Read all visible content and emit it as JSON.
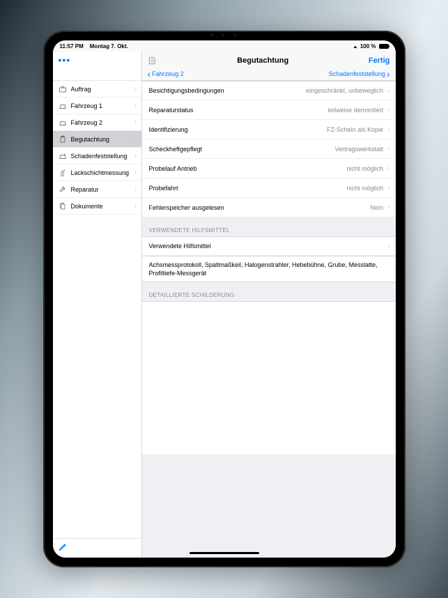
{
  "statusbar": {
    "time": "11:57 PM",
    "date": "Montag 7. Okt.",
    "battery": "100 %"
  },
  "sidebar": {
    "more_label": "•••",
    "items": [
      {
        "id": "auftrag",
        "label": "Auftrag",
        "icon": "briefcase"
      },
      {
        "id": "fahrzeug1",
        "label": "Fahrzeug 1",
        "icon": "car"
      },
      {
        "id": "fahrzeug2",
        "label": "Fahrzeug 2",
        "icon": "car"
      },
      {
        "id": "begutachtung",
        "label": "Begutachtung",
        "icon": "clipboard",
        "selected": true
      },
      {
        "id": "schadenfeststellung",
        "label": "Schadenfeststellung",
        "icon": "car-crash"
      },
      {
        "id": "lackschichtmessung",
        "label": "Lackschichtmessung",
        "icon": "spray"
      },
      {
        "id": "reparatur",
        "label": "Reparatur",
        "icon": "wrench"
      },
      {
        "id": "dokumente",
        "label": "Dokumente",
        "icon": "docs"
      }
    ]
  },
  "navbar": {
    "title": "Begutachtung",
    "done": "Fertig",
    "back": "Fahrzeug 2",
    "forward": "Schadenfeststellung"
  },
  "rows": [
    {
      "label": "Besichtigungsbedingungen",
      "value": "eingeschränkt, unbeweglich"
    },
    {
      "label": "Reparaturstatus",
      "value": "teilweise demontiert"
    },
    {
      "label": "Identifizierung",
      "value": "FZ-Schein als Kopie"
    },
    {
      "label": "Scheckheftgepflegt",
      "value": "Vertragswerkstatt"
    },
    {
      "label": "Probelauf Antrieb",
      "value": "nicht möglich"
    },
    {
      "label": "Probefahrt",
      "value": "nicht möglich"
    },
    {
      "label": "Fehlerspeicher ausgelesen",
      "value": "Nein"
    }
  ],
  "sections": {
    "tools_header": "Verwendete Hilfsmittel",
    "tools_row": "Verwendete Hilfsmittel",
    "tools_text": "Achsmessprotokoll, Spaltmaßkeil, Halogenstrahler, Hebebühne, Grube, Messlatte, Profiltiefe-Messgerät",
    "detail_header": "Detaillierte Schilderung"
  }
}
